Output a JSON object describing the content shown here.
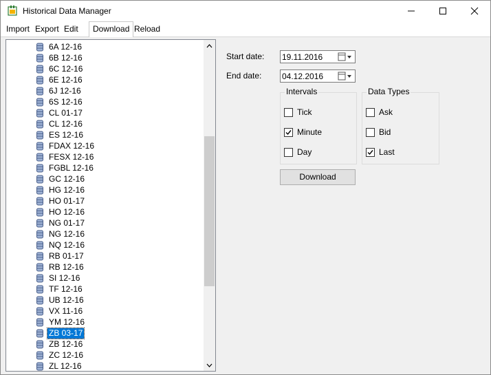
{
  "window": {
    "title": "Historical Data Manager",
    "icon": "app-icon",
    "controls": [
      "minimize-icon",
      "maximize-icon",
      "close-icon"
    ]
  },
  "menu": {
    "tabs": [
      "Import",
      "Export",
      "Edit",
      "Download",
      "Reload"
    ],
    "active": "Download"
  },
  "tree": {
    "items": [
      "6A 12-16",
      "6B 12-16",
      "6C 12-16",
      "6E 12-16",
      "6J 12-16",
      "6S 12-16",
      "CL 01-17",
      "CL 12-16",
      "ES 12-16",
      "FDAX 12-16",
      "FESX 12-16",
      "FGBL 12-16",
      "GC 12-16",
      "HG 12-16",
      "HO 01-17",
      "HO 12-16",
      "NG 01-17",
      "NG 12-16",
      "NQ 12-16",
      "RB 01-17",
      "RB 12-16",
      "SI 12-16",
      "TF 12-16",
      "UB 12-16",
      "VX 11-16",
      "YM 12-16",
      "ZB 03-17",
      "ZB 12-16",
      "ZC 12-16",
      "ZL 12-16"
    ],
    "selected": "ZB 03-17"
  },
  "form": {
    "start_label": "Start date:",
    "start_value": "19.11.2016",
    "end_label": "End date:",
    "end_value": "04.12.2016",
    "intervals_title": "Intervals",
    "intervals": [
      {
        "label": "Tick",
        "checked": false
      },
      {
        "label": "Minute",
        "checked": true
      },
      {
        "label": "Day",
        "checked": false
      }
    ],
    "datatypes_title": "Data Types",
    "datatypes": [
      {
        "label": "Ask",
        "checked": false
      },
      {
        "label": "Bid",
        "checked": false
      },
      {
        "label": "Last",
        "checked": true
      }
    ],
    "download_label": "Download"
  }
}
